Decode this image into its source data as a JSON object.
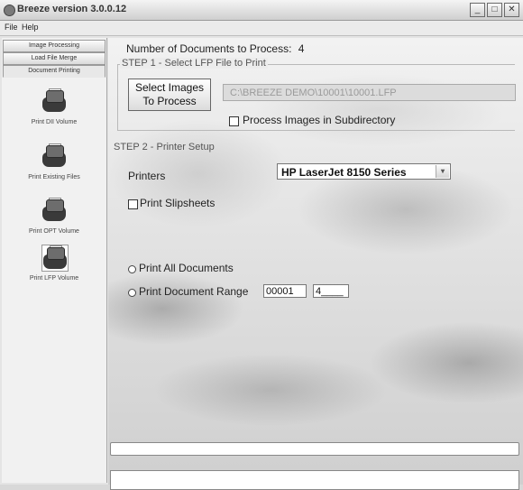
{
  "window": {
    "title": "Breeze version 3.0.0.12",
    "buttons": {
      "minimize": "_",
      "maximize": "□",
      "close": "✕"
    }
  },
  "menu": {
    "file": "File",
    "help": "Help"
  },
  "sidebar": {
    "nav": [
      "Image Processing",
      "Load File Merge",
      "Document Printing"
    ],
    "tools": [
      "Print DII Volume",
      "Print Existing Files",
      "Print OPT Volume",
      "Print LFP Volume"
    ]
  },
  "main": {
    "doc_count_label": "Number of Documents to Process:",
    "doc_count_value": "4",
    "step1_title": "STEP 1 - Select LFP File to Print",
    "select_images_line1": "Select Images",
    "select_images_line2": "To Process",
    "lfp_path": "C:\\BREEZE DEMO\\10001\\10001.LFP",
    "subdirectory_label": "Process Images in Subdirectory",
    "step2_title": "STEP 2 - Printer Setup",
    "printers_label": "Printers",
    "printer_selected": "HP LaserJet 8150 Series",
    "slipsheets_label": "Print Slipsheets",
    "print_all_label": "Print All Documents",
    "print_range_label": "Print Document Range",
    "range_start": "00001",
    "range_end": "4____"
  }
}
